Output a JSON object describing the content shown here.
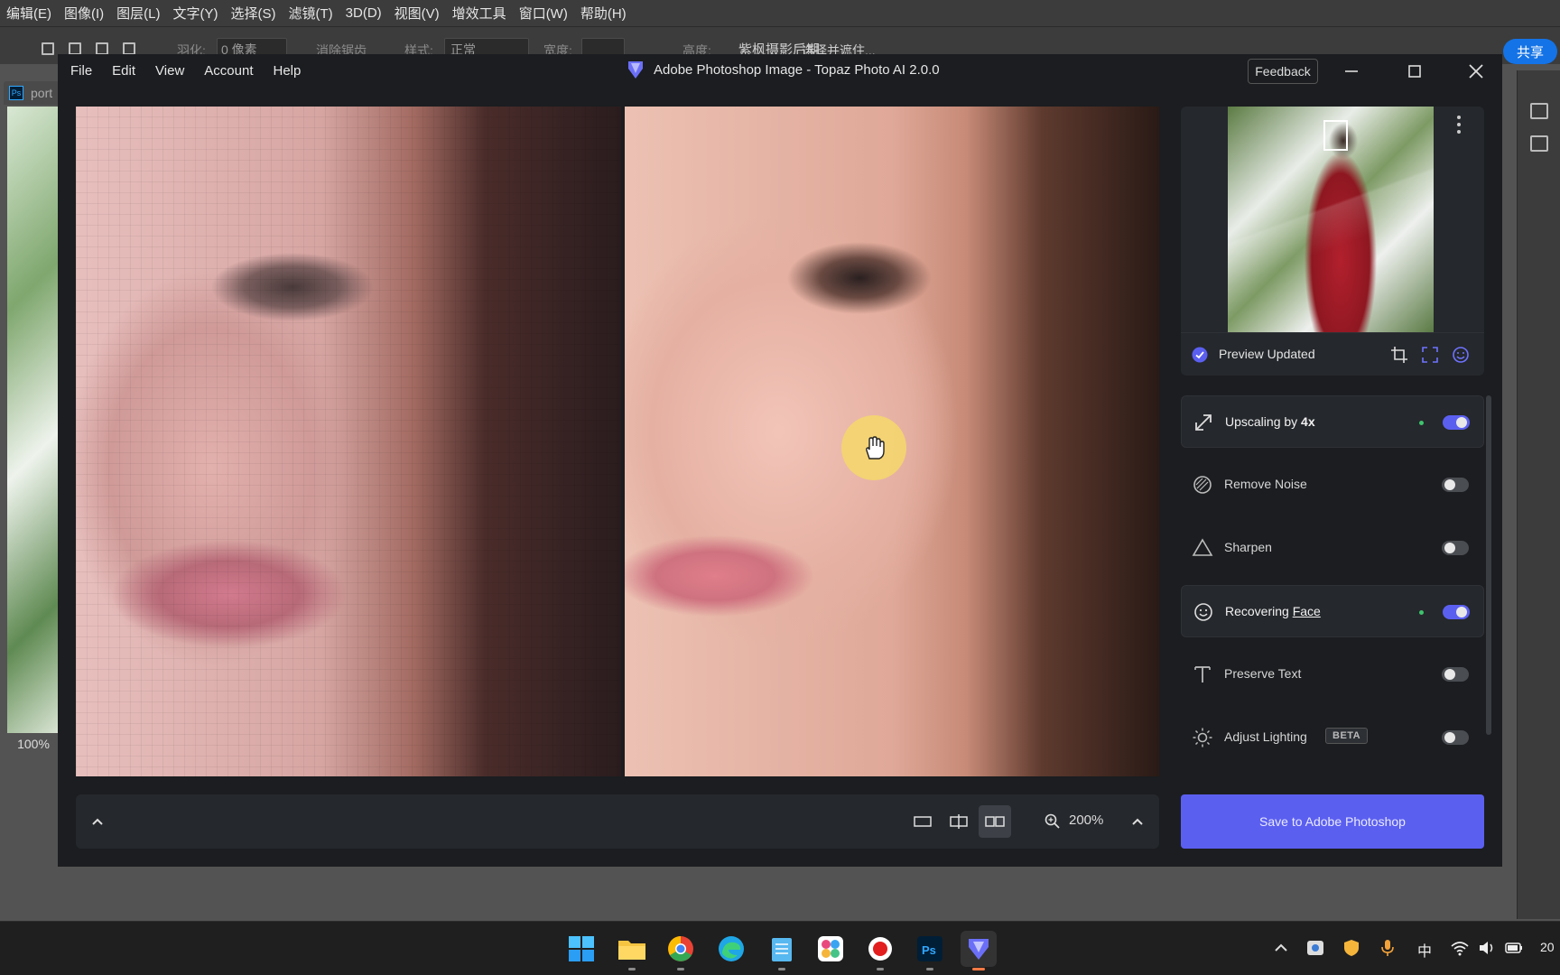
{
  "photoshop": {
    "menu": [
      "编辑(E)",
      "图像(I)",
      "图层(L)",
      "文字(Y)",
      "选择(S)",
      "滤镜(T)",
      "3D(D)",
      "视图(V)",
      "增效工具",
      "窗口(W)",
      "帮助(H)"
    ],
    "options": {
      "feather_label": "羽化:",
      "feather_value": "0 像素",
      "antialias": "消除锯齿",
      "style_label": "样式:",
      "style_value": "正常",
      "width_label": "宽度:",
      "height_label": "高度:",
      "select_subject": "选择并遮住...",
      "watermark": "紫枫摄影后期"
    },
    "share_label": "共享",
    "doc_tab": "port",
    "zoom": "100%"
  },
  "topaz": {
    "menu": [
      "File",
      "Edit",
      "View",
      "Account",
      "Help"
    ],
    "title": "Adobe Photoshop Image - Topaz Photo AI 2.0.0",
    "feedback": "Feedback",
    "preview_status": "Preview Updated",
    "zoom": "200%",
    "tools": [
      {
        "pre": "Upscaling by ",
        "bold": "4x",
        "enabled": true,
        "dot": true
      },
      {
        "pre": "Remove Noise",
        "enabled": false
      },
      {
        "pre": "Sharpen",
        "enabled": false
      },
      {
        "pre": "Recovering ",
        "under": "Face",
        "enabled": true,
        "dot": true
      },
      {
        "pre": "Preserve Text",
        "enabled": false
      },
      {
        "pre": "Adjust Lighting",
        "badge": "BETA",
        "enabled": false
      }
    ],
    "save_button": "Save to Adobe Photoshop",
    "accent": "#5b5ff0"
  },
  "taskbar": {
    "apps": [
      "windows-start",
      "file-explorer",
      "chrome",
      "edge",
      "notepad",
      "photos",
      "record",
      "photoshop",
      "topaz-photo-ai"
    ],
    "ime": "中",
    "clock": "20"
  }
}
